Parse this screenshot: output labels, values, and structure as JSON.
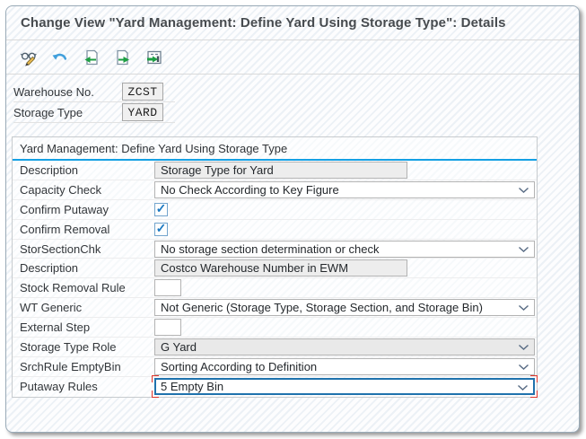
{
  "window": {
    "title": "Change View \"Yard Management: Define Yard Using Storage Type\": Details"
  },
  "toolbar": {
    "icons": [
      "display-change-icon",
      "undo-icon",
      "previous-entry-icon",
      "next-entry-icon",
      "other-entry-icon"
    ]
  },
  "header_fields": {
    "warehouse_no": {
      "label": "Warehouse No.",
      "value": "ZCST"
    },
    "storage_type": {
      "label": "Storage Type",
      "value": "YARD"
    }
  },
  "group": {
    "title": "Yard Management: Define Yard Using Storage Type",
    "rows": [
      {
        "label": "Description",
        "type": "readonly",
        "value": "Storage Type for Yard"
      },
      {
        "label": "Capacity Check",
        "type": "select",
        "value": "No Check According to Key Figure"
      },
      {
        "label": "Confirm Putaway",
        "type": "checkbox",
        "checked": true,
        "checkmark": "✓"
      },
      {
        "label": "Confirm Removal",
        "type": "checkbox",
        "checked": true,
        "checkmark": "✓"
      },
      {
        "label": "StorSectionChk",
        "type": "select",
        "value": "No storage section determination or check"
      },
      {
        "label": "Description",
        "type": "readonly",
        "value": "Costco Warehouse Number in EWM"
      },
      {
        "label": "Stock Removal Rule",
        "type": "input",
        "value": ""
      },
      {
        "label": "WT Generic",
        "type": "select",
        "value": "Not Generic (Storage Type, Storage Section, and Storage Bin)"
      },
      {
        "label": "External Step",
        "type": "input",
        "value": ""
      },
      {
        "label": "Storage Type Role",
        "type": "select-disabled",
        "value": "G Yard"
      },
      {
        "label": "SrchRule EmptyBin",
        "type": "select",
        "value": "Sorting According to Definition"
      },
      {
        "label": "Putaway Rules",
        "type": "select-focused",
        "value": "5 Empty Bin"
      }
    ]
  },
  "colors": {
    "group_underline": "#14a0e4",
    "focus_border": "#1f72ad",
    "cursor_marks": "#e0352b",
    "check": "#1a78c2",
    "green_arrow": "#1d9e43",
    "undo_blue": "#42a0dc"
  }
}
